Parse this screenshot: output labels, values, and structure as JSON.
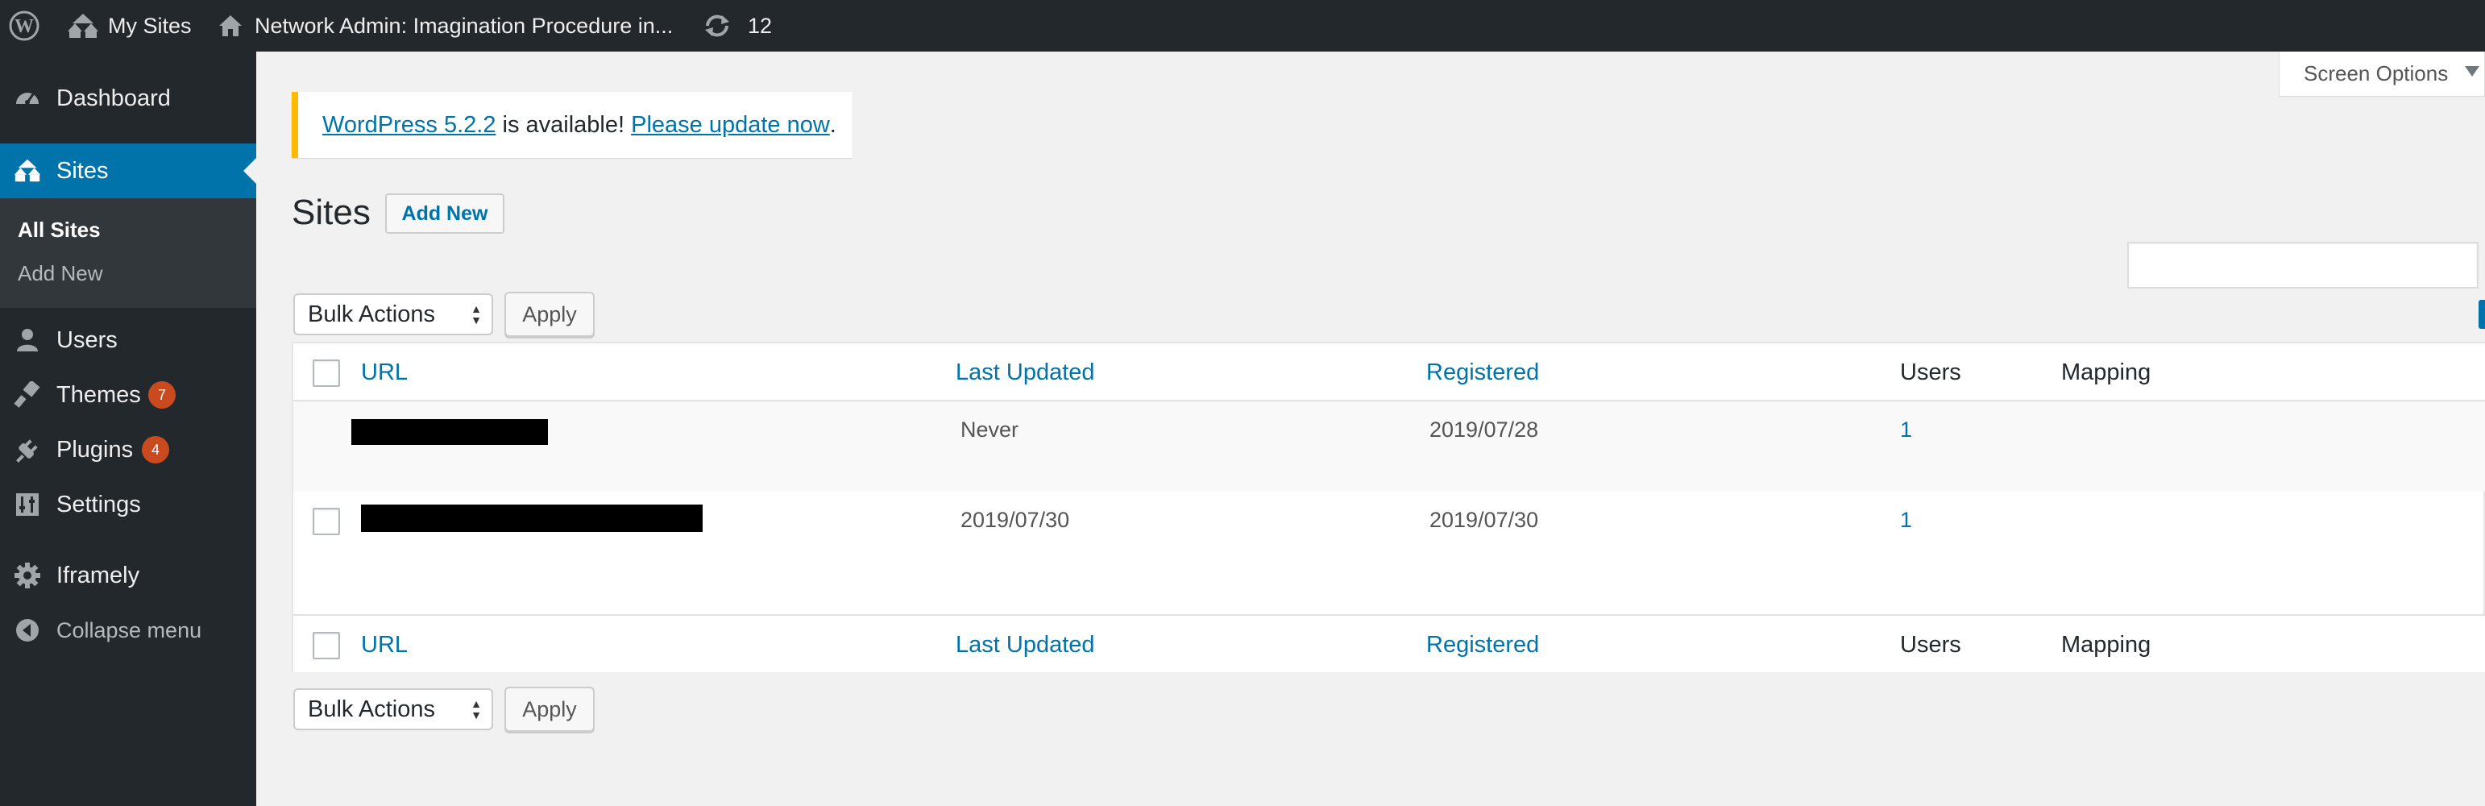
{
  "admin_bar": {
    "my_sites_label": "My Sites",
    "network_admin_label": "Network Admin: Imagination Procedure in...",
    "updates_count": "12",
    "icons": [
      "wordpress-logo-icon",
      "my-sites-icon",
      "home-icon",
      "updates-icon"
    ]
  },
  "sidebar": {
    "items": [
      {
        "label": "Dashboard",
        "icon": "dashboard-icon"
      },
      {
        "label": "Sites",
        "icon": "sites-icon",
        "current": true
      },
      {
        "label": "Users",
        "icon": "users-icon"
      },
      {
        "label": "Themes",
        "icon": "themes-icon",
        "badge": "7"
      },
      {
        "label": "Plugins",
        "icon": "plugins-icon",
        "badge": "4"
      },
      {
        "label": "Settings",
        "icon": "settings-icon"
      },
      {
        "label": "Iframely",
        "icon": "gear-icon"
      }
    ],
    "submenu": [
      "All Sites",
      "Add New"
    ],
    "collapse_label": "Collapse menu"
  },
  "screen_options": {
    "label": "Screen Options"
  },
  "notice": {
    "version_link": "WordPress 5.2.2",
    "middle_text": " is available! ",
    "update_link": "Please update now",
    "end_text": "."
  },
  "page": {
    "title": "Sites",
    "add_new_label": "Add New"
  },
  "bulk": {
    "select_value": "Bulk Actions",
    "apply_label": "Apply"
  },
  "table": {
    "columns": [
      "URL",
      "Last Updated",
      "Registered",
      "Users",
      "Mapping"
    ],
    "rows": [
      {
        "url": "",
        "last_updated": "Never",
        "registered": "2019/07/28",
        "users": "1",
        "mapping": ""
      },
      {
        "url": "",
        "last_updated": "2019/07/30",
        "registered": "2019/07/30",
        "users": "1",
        "mapping": ""
      }
    ]
  },
  "colors": {
    "admin_bar_bg": "#23282d",
    "sidebar_bg": "#23282d",
    "accent": "#0073aa",
    "notice_border": "#ffb900",
    "badge": "#ca4a1f",
    "page_bg": "#f1f1f1"
  }
}
